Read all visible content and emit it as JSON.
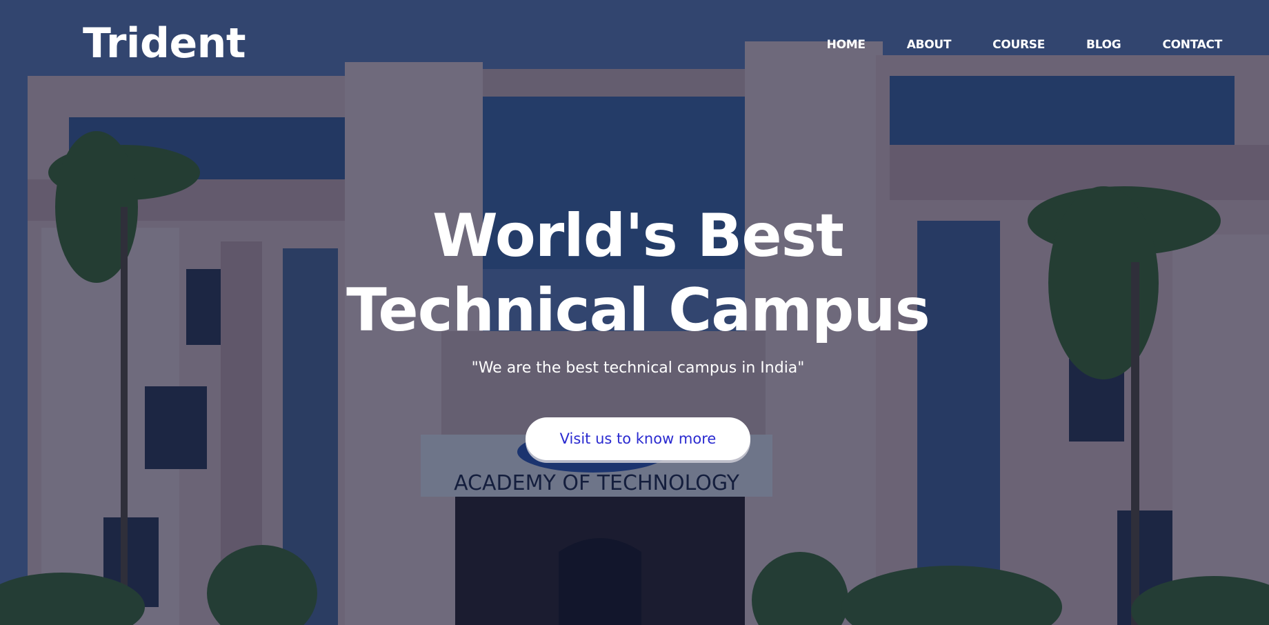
{
  "nav": {
    "brand": "Trident",
    "links": [
      "HOME",
      "ABOUT",
      "COURSE",
      "BLOG",
      "CONTACT"
    ]
  },
  "hero": {
    "headline_line1": "World's Best",
    "headline_line2": "Technical Campus",
    "tagline": "\"We are the best technical campus in India\"",
    "cta_label": "Visit us to know more",
    "building_sign": "ACADEMY OF TECHNOLOGY"
  },
  "colors": {
    "overlay": "#121c3a",
    "text": "#ffffff",
    "cta_text": "#2a2ad0",
    "cta_bg": "#ffffff"
  }
}
